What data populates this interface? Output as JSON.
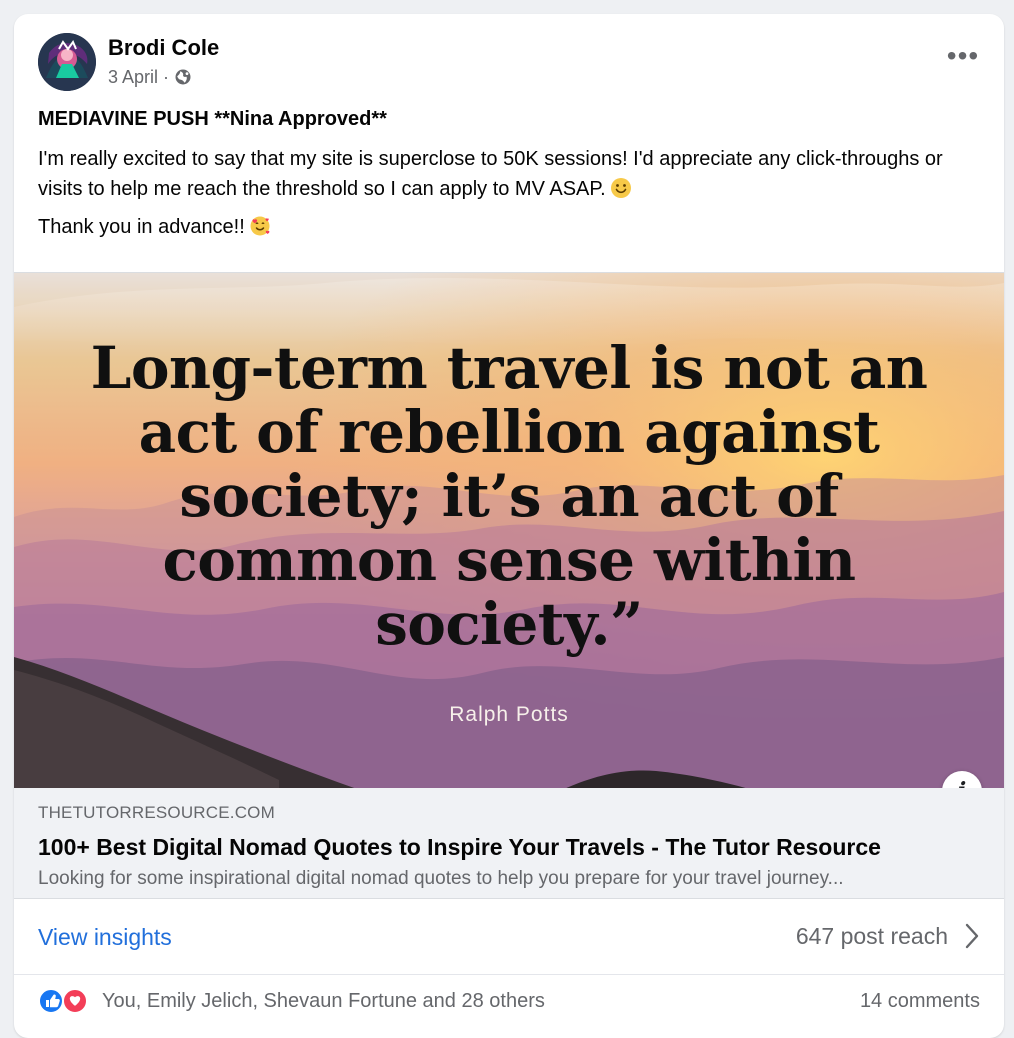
{
  "post": {
    "author": "Brodi Cole",
    "date": "3 April",
    "meta_separator": "·",
    "privacy_icon": "globe-icon",
    "more_label": "•••",
    "title": "MEDIAVINE PUSH **Nina Approved**",
    "body": "I'm really excited to say that my site is superclose to 50K sessions! I'd appreciate any click-throughs or visits to help me reach the threshold so I can apply to MV ASAP.",
    "body_emoji": "smiling-face-icon",
    "thanks": "Thank you in advance!!",
    "thanks_emoji": "smiling-face-with-hearts-icon"
  },
  "preview": {
    "quote": "Long-term travel is not an act of rebellion against society; it’s an act of common sense within society.”",
    "quote_author": "Ralph Potts",
    "info_label": "i"
  },
  "link": {
    "domain": "THETUTORRESOURCE.COM",
    "title": "100+ Best Digital Nomad Quotes to Inspire Your Travels - The Tutor Resource",
    "description": "Looking for some inspirational digital nomad quotes to help you prepare for your travel journey..."
  },
  "insights": {
    "view_label": "View insights",
    "reach_label": "647 post reach"
  },
  "engagement": {
    "reactions_text": "You, Emily Jelich, Shevaun Fortune and 28 others",
    "comments_text": "14 comments",
    "reaction_types": [
      "like-icon",
      "love-icon"
    ]
  },
  "colors": {
    "link_blue": "#216fdb",
    "secondary_text": "#65676b",
    "like_blue": "#1877f2",
    "love_red": "#f33e58"
  }
}
